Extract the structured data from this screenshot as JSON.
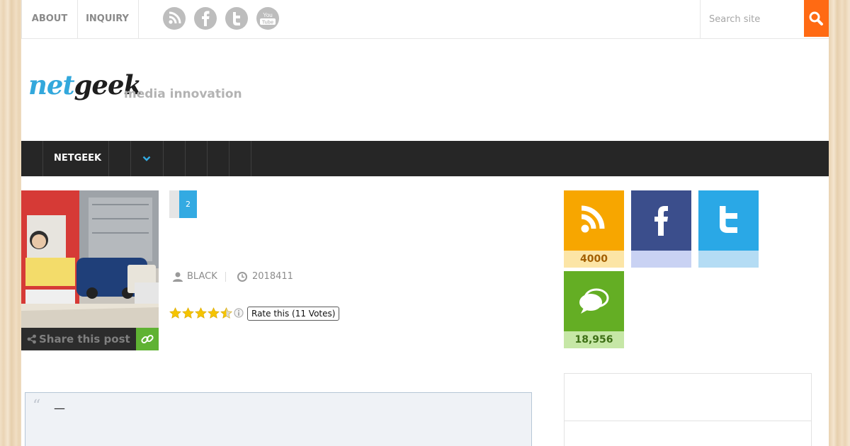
{
  "topbar": {
    "links": [
      "ABOUT",
      "INQUIRY"
    ],
    "social": [
      {
        "name": "rss-icon",
        "color": "#bdbdbd"
      },
      {
        "name": "facebook-icon",
        "color": "#bdbdbd"
      },
      {
        "name": "twitter-icon",
        "color": "#bdbdbd"
      },
      {
        "name": "youtube-icon",
        "color": "#bdbdbd"
      }
    ],
    "youtube_you": "You",
    "youtube_tube": "Tube",
    "search_placeholder": "Search site",
    "search_icon": "search-icon",
    "search_color": "#ff6a13"
  },
  "brand": {
    "logo_net": "net",
    "logo_geek": "geek",
    "tagline": "media innovation"
  },
  "nav": {
    "first": "NETGEEK",
    "dropdown_icon": "chevron-down-icon"
  },
  "post": {
    "share_label": "Share this post",
    "share_icon": "share-icon",
    "link_icon": "link-icon",
    "current_page": "2",
    "author": "BLACK",
    "date": "2018411",
    "rating": {
      "stars": 4.5,
      "max": 5,
      "label": "Rate this (11 Votes)"
    }
  },
  "widgets": {
    "rss": {
      "count": "4000",
      "icon": "rss-icon",
      "color": "#f7a600",
      "band": "#fce5a6",
      "text": "#a35f00"
    },
    "facebook": {
      "count": "",
      "icon": "facebook-icon",
      "color": "#3b4e8c",
      "band": "#c9d2f3"
    },
    "twitter": {
      "count": "",
      "icon": "twitter-icon",
      "color": "#2aa8e6",
      "band": "#b4dcf4"
    },
    "comments": {
      "count": "18,956",
      "icon": "chat-bubbles-icon",
      "color": "#64ae24",
      "band": "#c6e7a6",
      "text": "#3d6f15"
    }
  },
  "quote": {
    "mark": "“",
    "text": "—"
  }
}
